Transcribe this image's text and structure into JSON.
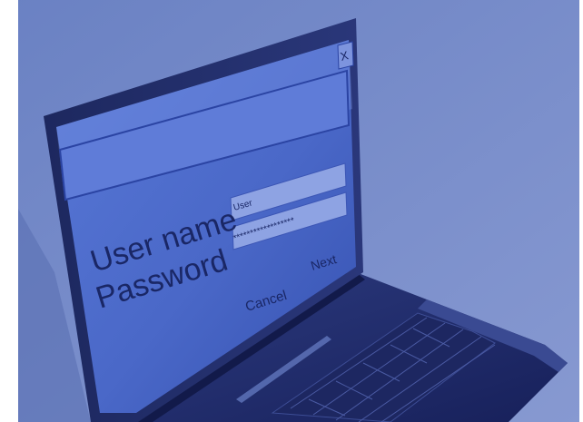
{
  "login_dialog": {
    "close_label": "X",
    "username_label": "User name",
    "password_label": "Password",
    "username_value": "User",
    "password_value": "******************",
    "cancel_label": "Cancel",
    "next_label": "Next"
  },
  "colors": {
    "background_top": "#6f86c6",
    "background_bottom": "#8a9bd2",
    "laptop_body": "#1f2a63",
    "screen_blue": "#4663c6",
    "screen_light": "#6b86dc",
    "title_bar": "#5673cf",
    "field_fill": "#8ea3e3",
    "text_dark": "#1a2766"
  }
}
